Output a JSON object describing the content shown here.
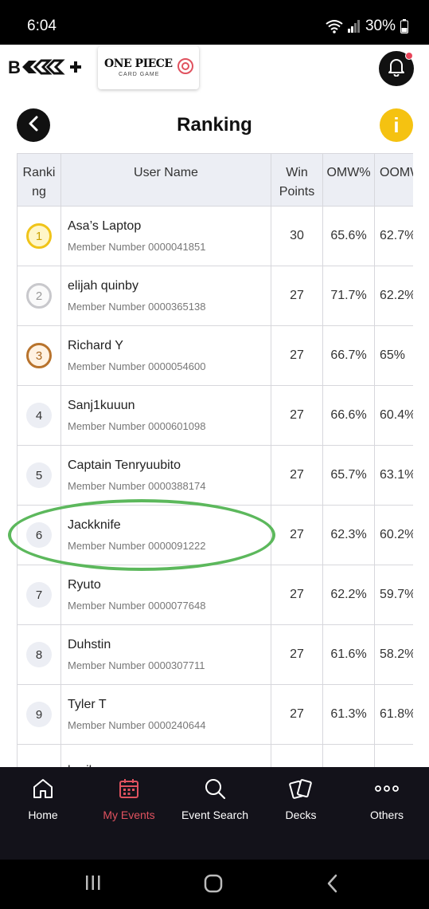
{
  "status": {
    "time": "6:04",
    "battery": "30%"
  },
  "header": {
    "brand": "Bandai Card Games Plus",
    "game_logo_title": "ONE PIECE",
    "game_logo_sub": "CARD GAME"
  },
  "page": {
    "title": "Ranking",
    "info": "i"
  },
  "table": {
    "headers": {
      "rank": "Ranki ng",
      "name": "User Name",
      "points": "Win Points",
      "omw": "OMW%",
      "oomw": "OOMW"
    },
    "rows": [
      {
        "rank": "1",
        "name": "Asa’s Laptop",
        "member": "Member Number 0000041851",
        "points": "30",
        "omw": "65.6%",
        "oomw": "62.7%"
      },
      {
        "rank": "2",
        "name": "elijah quinby",
        "member": "Member Number 0000365138",
        "points": "27",
        "omw": "71.7%",
        "oomw": "62.2%"
      },
      {
        "rank": "3",
        "name": "Richard Y",
        "member": "Member Number 0000054600",
        "points": "27",
        "omw": "66.7%",
        "oomw": "65%"
      },
      {
        "rank": "4",
        "name": "Sanj1kuuun",
        "member": "Member Number 0000601098",
        "points": "27",
        "omw": "66.6%",
        "oomw": "60.4%"
      },
      {
        "rank": "5",
        "name": "Captain Tenryuubito",
        "member": "Member Number 0000388174",
        "points": "27",
        "omw": "65.7%",
        "oomw": "63.1%"
      },
      {
        "rank": "6",
        "name": "Jackknife",
        "member": "Member Number 0000091222",
        "points": "27",
        "omw": "62.3%",
        "oomw": "60.2%"
      },
      {
        "rank": "7",
        "name": "Ryuto",
        "member": "Member Number 0000077648",
        "points": "27",
        "omw": "62.2%",
        "oomw": "59.7%"
      },
      {
        "rank": "8",
        "name": "Duhstin",
        "member": "Member Number 0000307711",
        "points": "27",
        "omw": "61.6%",
        "oomw": "58.2%"
      },
      {
        "rank": "9",
        "name": "Tyler T",
        "member": "Member Number 0000240644",
        "points": "27",
        "omw": "61.3%",
        "oomw": "61.8%"
      },
      {
        "rank": "",
        "name": "breikur",
        "member": "",
        "points": "",
        "omw": "",
        "oomw": ""
      }
    ]
  },
  "nav": {
    "items": [
      {
        "label": "Home",
        "icon": "home-icon"
      },
      {
        "label": "My Events",
        "icon": "calendar-icon"
      },
      {
        "label": "Event Search",
        "icon": "search-icon"
      },
      {
        "label": "Decks",
        "icon": "cards-icon"
      },
      {
        "label": "Others",
        "icon": "more-icon"
      }
    ]
  },
  "colors": {
    "accent_active": "#e0525f",
    "highlight": "#5cb85c",
    "info": "#f5c211"
  }
}
